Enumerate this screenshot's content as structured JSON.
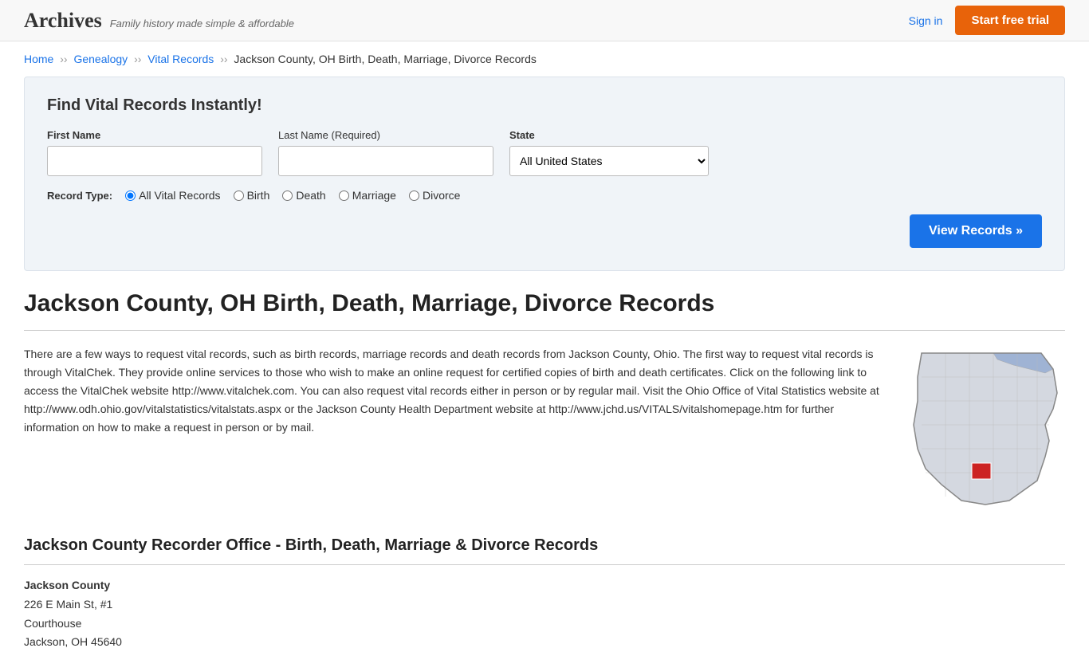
{
  "header": {
    "logo": "Archives",
    "tagline": "Family history made simple & affordable",
    "signin_label": "Sign in",
    "trial_label": "Start free trial"
  },
  "breadcrumb": {
    "home": "Home",
    "genealogy": "Genealogy",
    "vital_records": "Vital Records",
    "current": "Jackson County, OH Birth, Death, Marriage, Divorce Records"
  },
  "search": {
    "title": "Find Vital Records Instantly!",
    "first_name_label": "First Name",
    "last_name_label": "Last Name",
    "last_name_required": "(Required)",
    "state_label": "State",
    "state_default": "All United States",
    "record_type_label": "Record Type:",
    "record_types": [
      "All Vital Records",
      "Birth",
      "Death",
      "Marriage",
      "Divorce"
    ],
    "view_records_btn": "View Records »"
  },
  "page": {
    "title": "Jackson County, OH Birth, Death, Marriage, Divorce Records",
    "body_text": "There are a few ways to request vital records, such as birth records, marriage records and death records from Jackson County, Ohio. The first way to request vital records is through VitalChek. They provide online services to those who wish to make an online request for certified copies of birth and death certificates. Click on the following link to access the VitalChek website http://www.vitalchek.com. You can also request vital records either in person or by regular mail. Visit the Ohio Office of Vital Statistics website at http://www.odh.ohio.gov/vitalstatistics/vitalstats.aspx or the Jackson County Health Department website at http://www.jchd.us/VITALS/vitalshomepage.htm for further information on how to make a request in person or by mail.",
    "recorder_title": "Jackson County Recorder Office - Birth, Death, Marriage & Divorce Records",
    "office_name": "Jackson County",
    "office_address1": "226 E Main St, #1",
    "office_address2": "Courthouse",
    "office_address3": "Jackson, OH 45640"
  }
}
